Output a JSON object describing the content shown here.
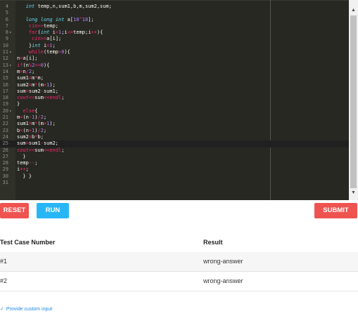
{
  "editor": {
    "colors": {
      "background": "#272822",
      "default": "#f8f8f2",
      "keyword": "#f92672",
      "type": "#66d9ef",
      "number": "#ae81ff",
      "gutter_text": "#8f908a"
    },
    "lines": [
      {
        "n": "4",
        "fold": "",
        "text": "   int temp,n,sum1,b,m,sum2,sum;"
      },
      {
        "n": "5",
        "fold": "",
        "text": ""
      },
      {
        "n": "6",
        "fold": "",
        "text": "   long long int a[10^18];"
      },
      {
        "n": "7",
        "fold": "",
        "text": "    cin>>temp;"
      },
      {
        "n": "8",
        "fold": "▾",
        "text": "    for(int i=1;i<=temp;i++){"
      },
      {
        "n": "9",
        "fold": "",
        "text": "     cin>>a[i];"
      },
      {
        "n": "10",
        "fold": "",
        "text": "    }int i=1;"
      },
      {
        "n": "11",
        "fold": "▾",
        "text": "    while(temp>0){"
      },
      {
        "n": "12",
        "fold": "",
        "text": "n=a[i];"
      },
      {
        "n": "13",
        "fold": "▾",
        "text": "if(n%2==0){"
      },
      {
        "n": "14",
        "fold": "",
        "text": "m=n/2;"
      },
      {
        "n": "15",
        "fold": "",
        "text": "sum1=m*m;"
      },
      {
        "n": "16",
        "fold": "",
        "text": "sum2=m*(m+1);"
      },
      {
        "n": "17",
        "fold": "",
        "text": "sum=sum2-sum1;"
      },
      {
        "n": "18",
        "fold": "",
        "text": "cout<<sum<<endl;"
      },
      {
        "n": "19",
        "fold": "",
        "text": "}"
      },
      {
        "n": "20",
        "fold": "▾",
        "text": "  else{"
      },
      {
        "n": "21",
        "fold": "",
        "text": "m=(n-1)/2;"
      },
      {
        "n": "22",
        "fold": "",
        "text": "sum1=m*(m+1);"
      },
      {
        "n": "23",
        "fold": "",
        "text": "b=(n+1)/2;"
      },
      {
        "n": "24",
        "fold": "",
        "text": "sum2=b*b;"
      },
      {
        "n": "25",
        "fold": "",
        "text": "sum=sum1-sum2;"
      },
      {
        "n": "26",
        "fold": "",
        "text": "cout<<sum<<endl;"
      },
      {
        "n": "27",
        "fold": "",
        "text": "  }"
      },
      {
        "n": "28",
        "fold": "",
        "text": "temp--;"
      },
      {
        "n": "29",
        "fold": "",
        "text": "i++;"
      },
      {
        "n": "30",
        "fold": "",
        "text": "  } }"
      },
      {
        "n": "31",
        "fold": "",
        "text": ""
      }
    ],
    "active_line": "25",
    "scroll_up_icon": "triangle-up-icon",
    "scroll_down_icon": "triangle-down-icon"
  },
  "buttons": {
    "reset": "RESET",
    "run": "RUN",
    "submit": "SUBMIT",
    "reset_color": "#ef5350",
    "run_color": "#29b6f6"
  },
  "results": {
    "headers": [
      "Test Case Number",
      "Result"
    ],
    "rows": [
      {
        "case": "#1",
        "result": "wrong-answer"
      },
      {
        "case": "#2",
        "result": "wrong-answer"
      }
    ]
  },
  "custom_input": {
    "label": "Provide custom input",
    "icon": "checkmark-icon"
  }
}
